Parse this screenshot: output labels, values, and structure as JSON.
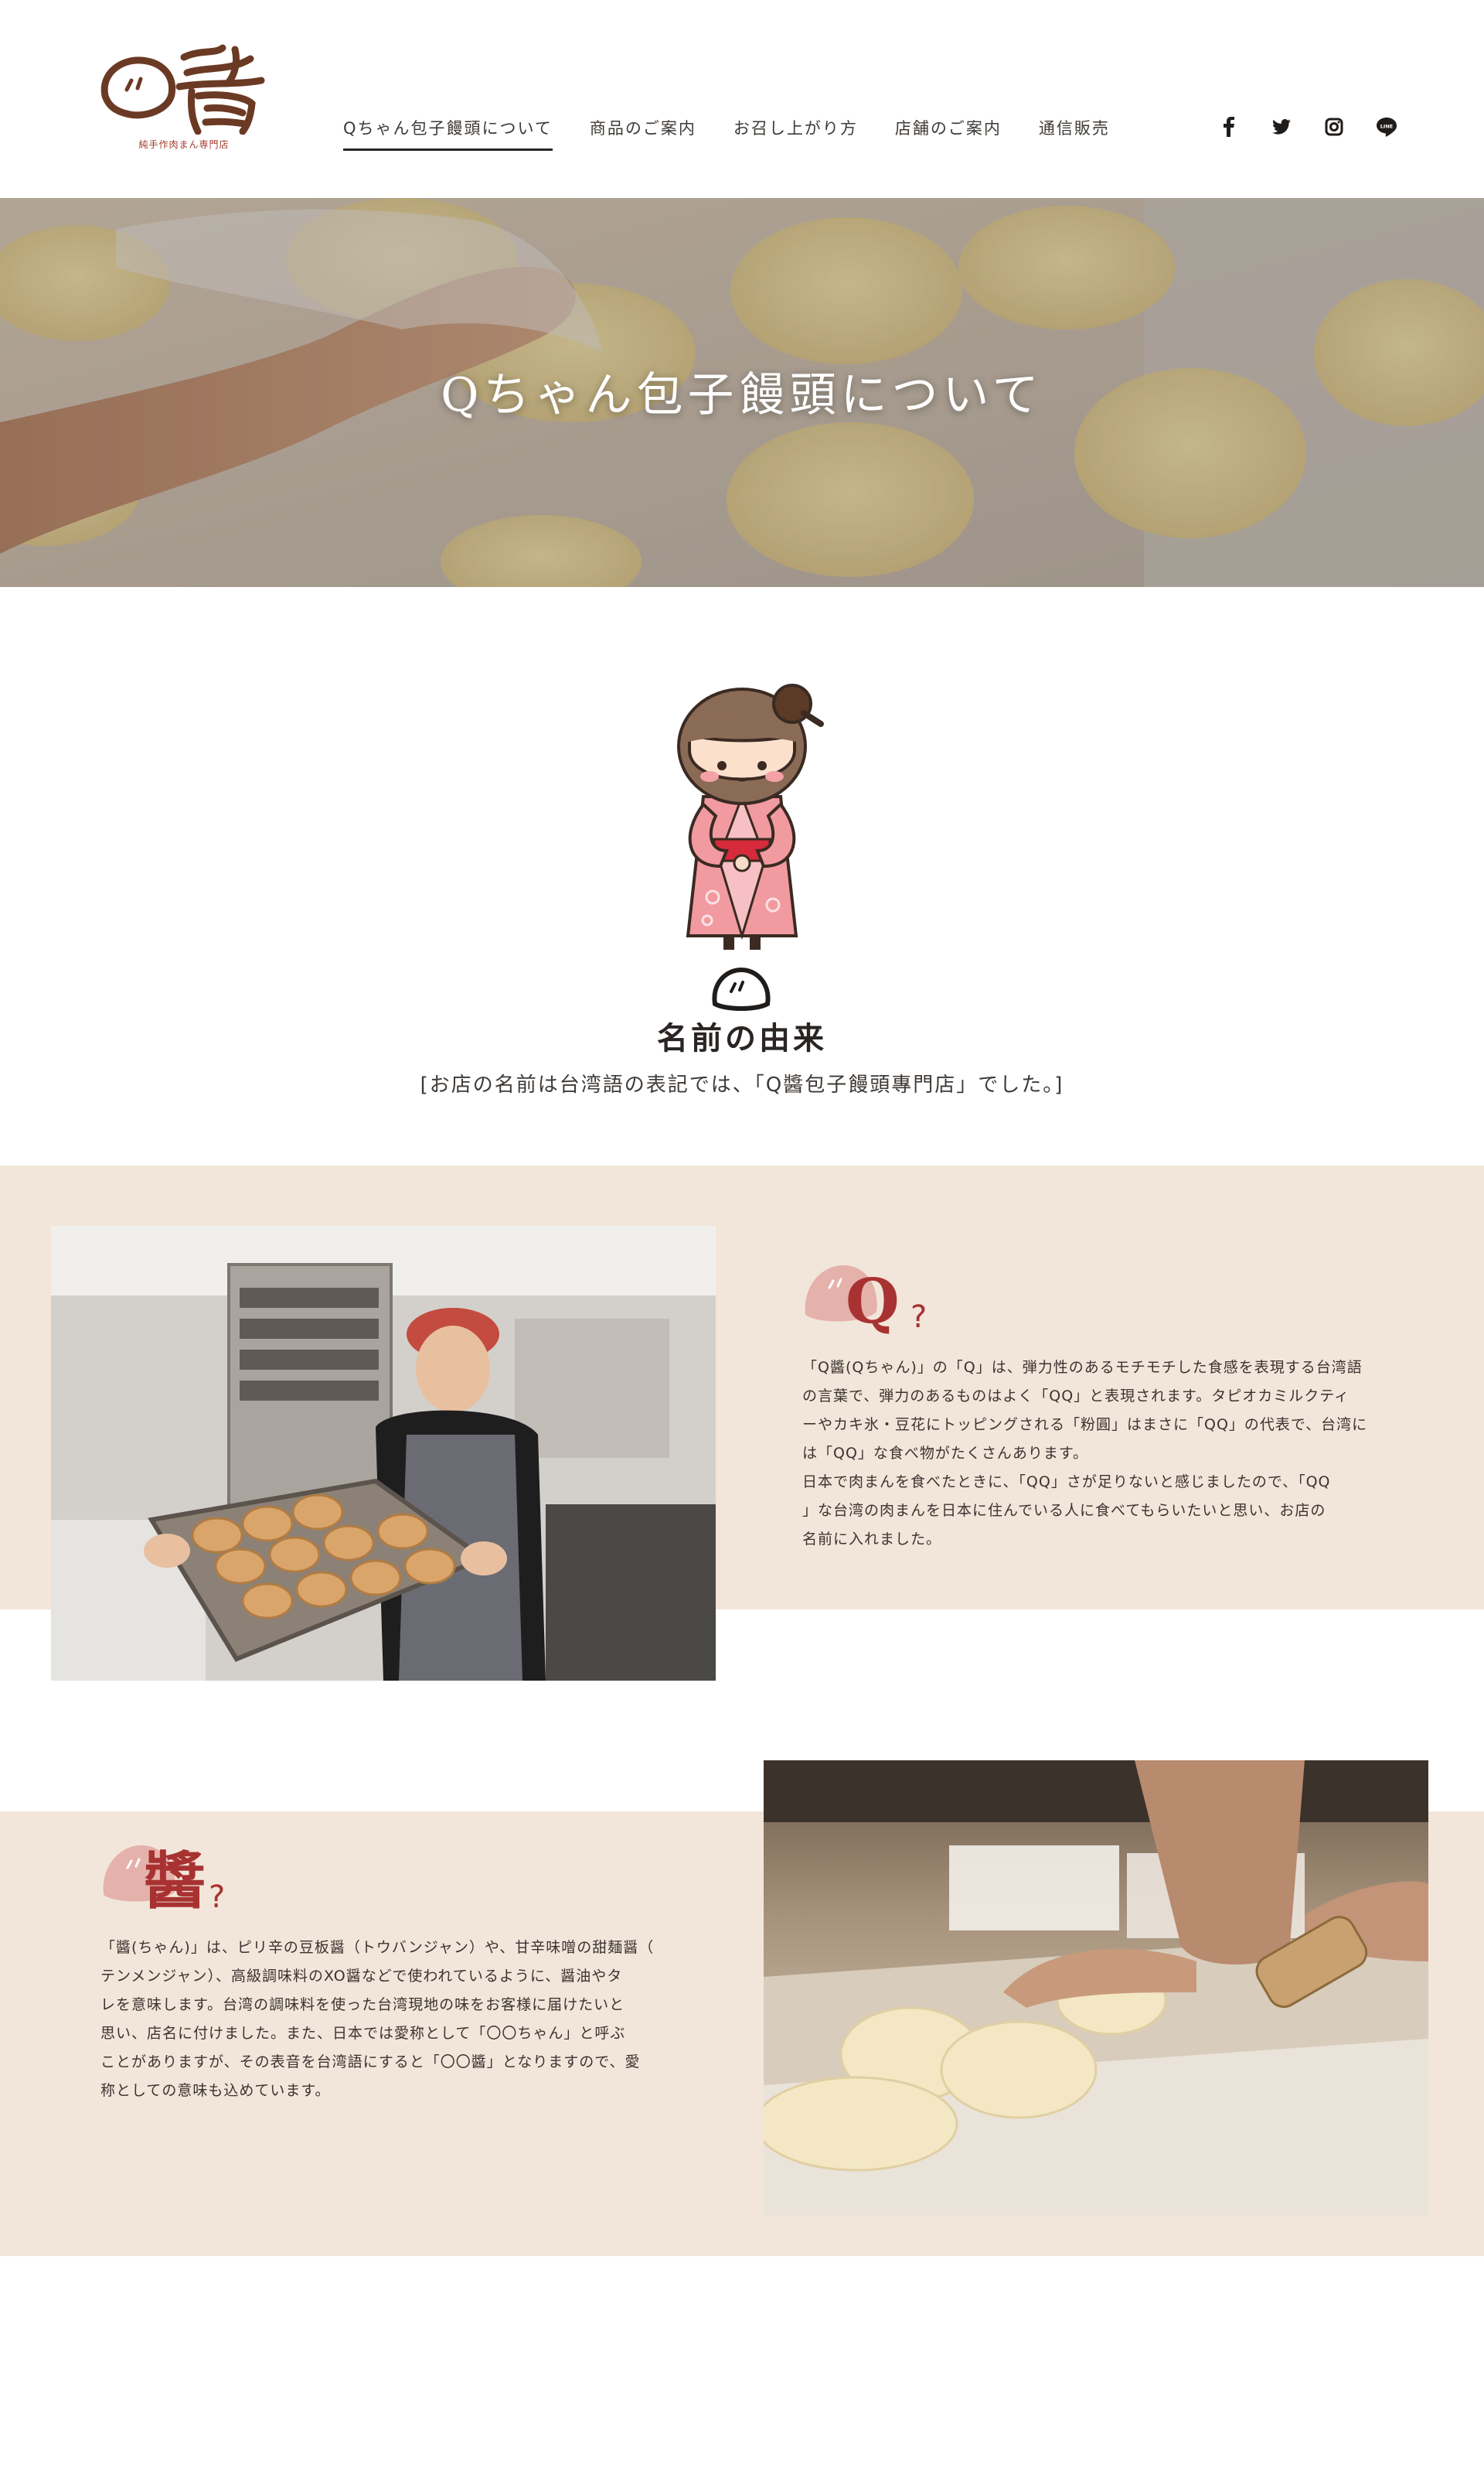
{
  "header": {
    "logo_subtitle": "純手作肉まん専門店",
    "nav": [
      {
        "label": "Qちゃん包子饅頭について",
        "active": true
      },
      {
        "label": "商品のご案内",
        "active": false
      },
      {
        "label": "お召し上がり方",
        "active": false
      },
      {
        "label": "店舗のご案内",
        "active": false
      },
      {
        "label": "通信販売",
        "active": false
      }
    ],
    "social": [
      "facebook-icon",
      "twitter-icon",
      "instagram-icon",
      "line-icon"
    ]
  },
  "hero": {
    "title": "Qちゃん包子饅頭について"
  },
  "origin": {
    "title": "名前の由来",
    "description": "[お店の名前は台湾語の表記では、「Q醬包子饅頭專門店」でした。]"
  },
  "sections": [
    {
      "heading_char": "Q",
      "heading_mark": "?",
      "body": "「Q醬(Qちゃん)」の「Q」は、弾力性のあるモチモチした食感を表現する台湾語\nの言葉で、弾力のあるものはよく「QQ」と表現されます。タピオカミルクティ\nーやカキ氷・豆花にトッピングされる「粉圓」はまさに「QQ」の代表で、台湾に\nは「QQ」な食べ物がたくさんあります。\n日本で肉まんを食べたときに、「QQ」さが足りないと感じましたので、「QQ\n」な台湾の肉まんを日本に住んでいる人に食べてもらいたいと思い、お店の\n名前に入れました。"
    },
    {
      "heading_char": "醬",
      "heading_mark": "?",
      "body": "「醬(ちゃん)」は、ピリ辛の豆板醤（トウバンジャン）や、甘辛味噌の甜麺醤（\nテンメンジャン）、高級調味料のXO醤などで使われているように、醤油やタ\nレを意味します。台湾の調味料を使った台湾現地の味をお客様に届けたいと\n思い、店名に付けました。また、日本では愛称として「〇〇ちゃん」と呼ぶ\nことがありますが、その表音を台湾語にすると「〇〇醬」となりますので、愛\n称としての意味も込めています。"
    }
  ],
  "colors": {
    "accent": "#a83232",
    "band_background": "#f2e6da",
    "logo_brown": "#6b3a24"
  }
}
